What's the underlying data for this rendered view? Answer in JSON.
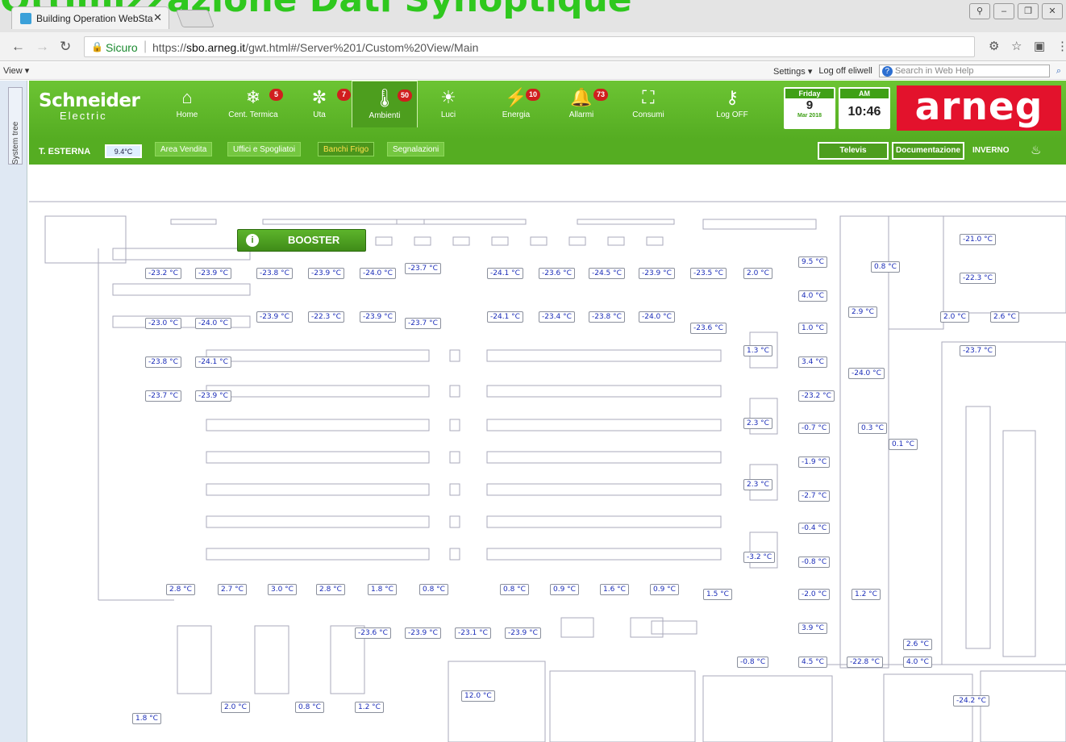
{
  "banner": "Ottimizzazione Dati Synoptique",
  "browser": {
    "tab_title": "Building Operation WebSta",
    "secure_label": "Sicuro",
    "url_prefix": "https://",
    "url_host": "sbo.arneg.it",
    "url_path": "/gwt.html#/Server%201/Custom%20View/Main"
  },
  "menubar": {
    "view": "View ▾",
    "settings": "Settings ▾",
    "logoff": "Log off eliwell",
    "help_placeholder": "Search in Web Help"
  },
  "systree_label": "System tree",
  "brand": {
    "line1": "Schneider",
    "line2": "Electric",
    "arneg": "arneg"
  },
  "nav": [
    {
      "label": "Home"
    },
    {
      "label": "Cent. Termica",
      "badge": "5"
    },
    {
      "label": "Uta",
      "badge": "7"
    },
    {
      "label": "Ambienti",
      "badge": "50"
    },
    {
      "label": "Luci"
    },
    {
      "label": "Energia",
      "badge": "10"
    },
    {
      "label": "Allarmi",
      "badge": "73"
    },
    {
      "label": "Consumi"
    },
    {
      "label": "Log OFF"
    }
  ],
  "date": {
    "day": "Friday",
    "num": "9",
    "month": "Mar 2018",
    "ampm": "AM",
    "time": "10:46"
  },
  "subbar": {
    "t_label": "T. ESTERNA",
    "t_value": "9.4°C",
    "tabs": [
      "Area Vendita",
      "Uffici e Spogliatoi",
      "Banchi Frigo",
      "Segnalazioni"
    ],
    "televis": "Televis",
    "documentazione": "Documentazione",
    "season": "INVERNO"
  },
  "booster": "BOOSTER",
  "temps": [
    "-23.2 °C",
    "-23.9 °C",
    "-23.8 °C",
    "-23.9 °C",
    "-24.0 °C",
    "-23.7 °C",
    "-24.1 °C",
    "-23.6 °C",
    "-24.5 °C",
    "-23.9 °C",
    "-23.5 °C",
    "-23.9 °C",
    "-22.3 °C",
    "-23.9 °C",
    "-23.0 °C",
    "-24.0 °C",
    "-23.7 °C",
    "-24.1 °C",
    "-23.4 °C",
    "-23.8 °C",
    "-24.0 °C",
    "-23.6 °C",
    "-23.8 °C",
    "-24.1 °C",
    "-23.7 °C",
    "-23.9 °C",
    "2.0 °C",
    "9.5 °C",
    "4.0 °C",
    "1.0 °C",
    "1.3 °C",
    "3.4 °C",
    "-23.2 °C",
    "2.3 °C",
    "-0.7 °C",
    "-1.9 °C",
    "2.3 °C",
    "-2.7 °C",
    "-0.4 °C",
    "-3.2 °C",
    "-0.8 °C",
    "-2.0 °C",
    "3.9 °C",
    "4.5 °C",
    "-0.8 °C",
    "0.8 °C",
    "2.9 °C",
    "-24.0 °C",
    "0.3 °C",
    "0.1 °C",
    "1.2 °C",
    "-22.8 °C",
    "2.6 °C",
    "4.0 °C",
    "-21.0 °C",
    "-22.3 °C",
    "2.0 °C",
    "2.6 °C",
    "-23.7 °C",
    "2.8 °C",
    "2.7 °C",
    "3.0 °C",
    "2.8 °C",
    "1.8 °C",
    "0.8 °C",
    "0.8 °C",
    "0.9 °C",
    "1.6 °C",
    "0.9 °C",
    "1.5 °C",
    "-23.6 °C",
    "-23.9 °C",
    "-23.1 °C",
    "-23.9 °C",
    "12.0 °C",
    "2.0 °C",
    "0.8 °C",
    "1.2 °C",
    "1.8 °C",
    "-24.2 °C"
  ]
}
